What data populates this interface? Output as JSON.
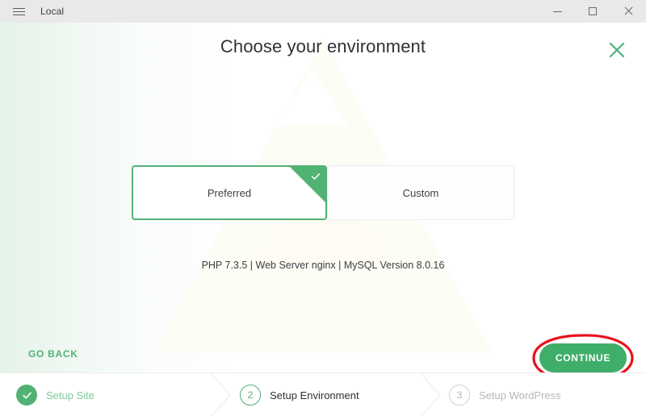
{
  "window": {
    "title": "Local",
    "menu_icon": "hamburger-icon",
    "controls": {
      "minimize": "minimize-icon",
      "maximize": "maximize-icon",
      "close": "close-icon"
    }
  },
  "page": {
    "title": "Choose your environment",
    "close_icon": "close-x-icon"
  },
  "environment": {
    "options": [
      {
        "label": "Preferred",
        "selected": true,
        "check_icon": "check-icon"
      },
      {
        "label": "Custom",
        "selected": false
      }
    ],
    "specs": "PHP 7.3.5 | Web Server nginx | MySQL Version 8.0.16"
  },
  "actions": {
    "back_label": "GO BACK",
    "continue_label": "CONTINUE",
    "annotation": "red-ellipse-highlight"
  },
  "steps": [
    {
      "number": "1",
      "label": "Setup Site",
      "state": "done",
      "icon": "check-icon"
    },
    {
      "number": "2",
      "label": "Setup Environment",
      "state": "active"
    },
    {
      "number": "3",
      "label": "Setup WordPress",
      "state": "todo"
    }
  ],
  "colors": {
    "accent_green": "#51b274",
    "button_green": "#3fae6a",
    "annotation_red": "#e8121c",
    "titlebar_gray": "#e9e9e9",
    "text_dark": "#2f3133",
    "text_muted": "#b3b7ba"
  }
}
